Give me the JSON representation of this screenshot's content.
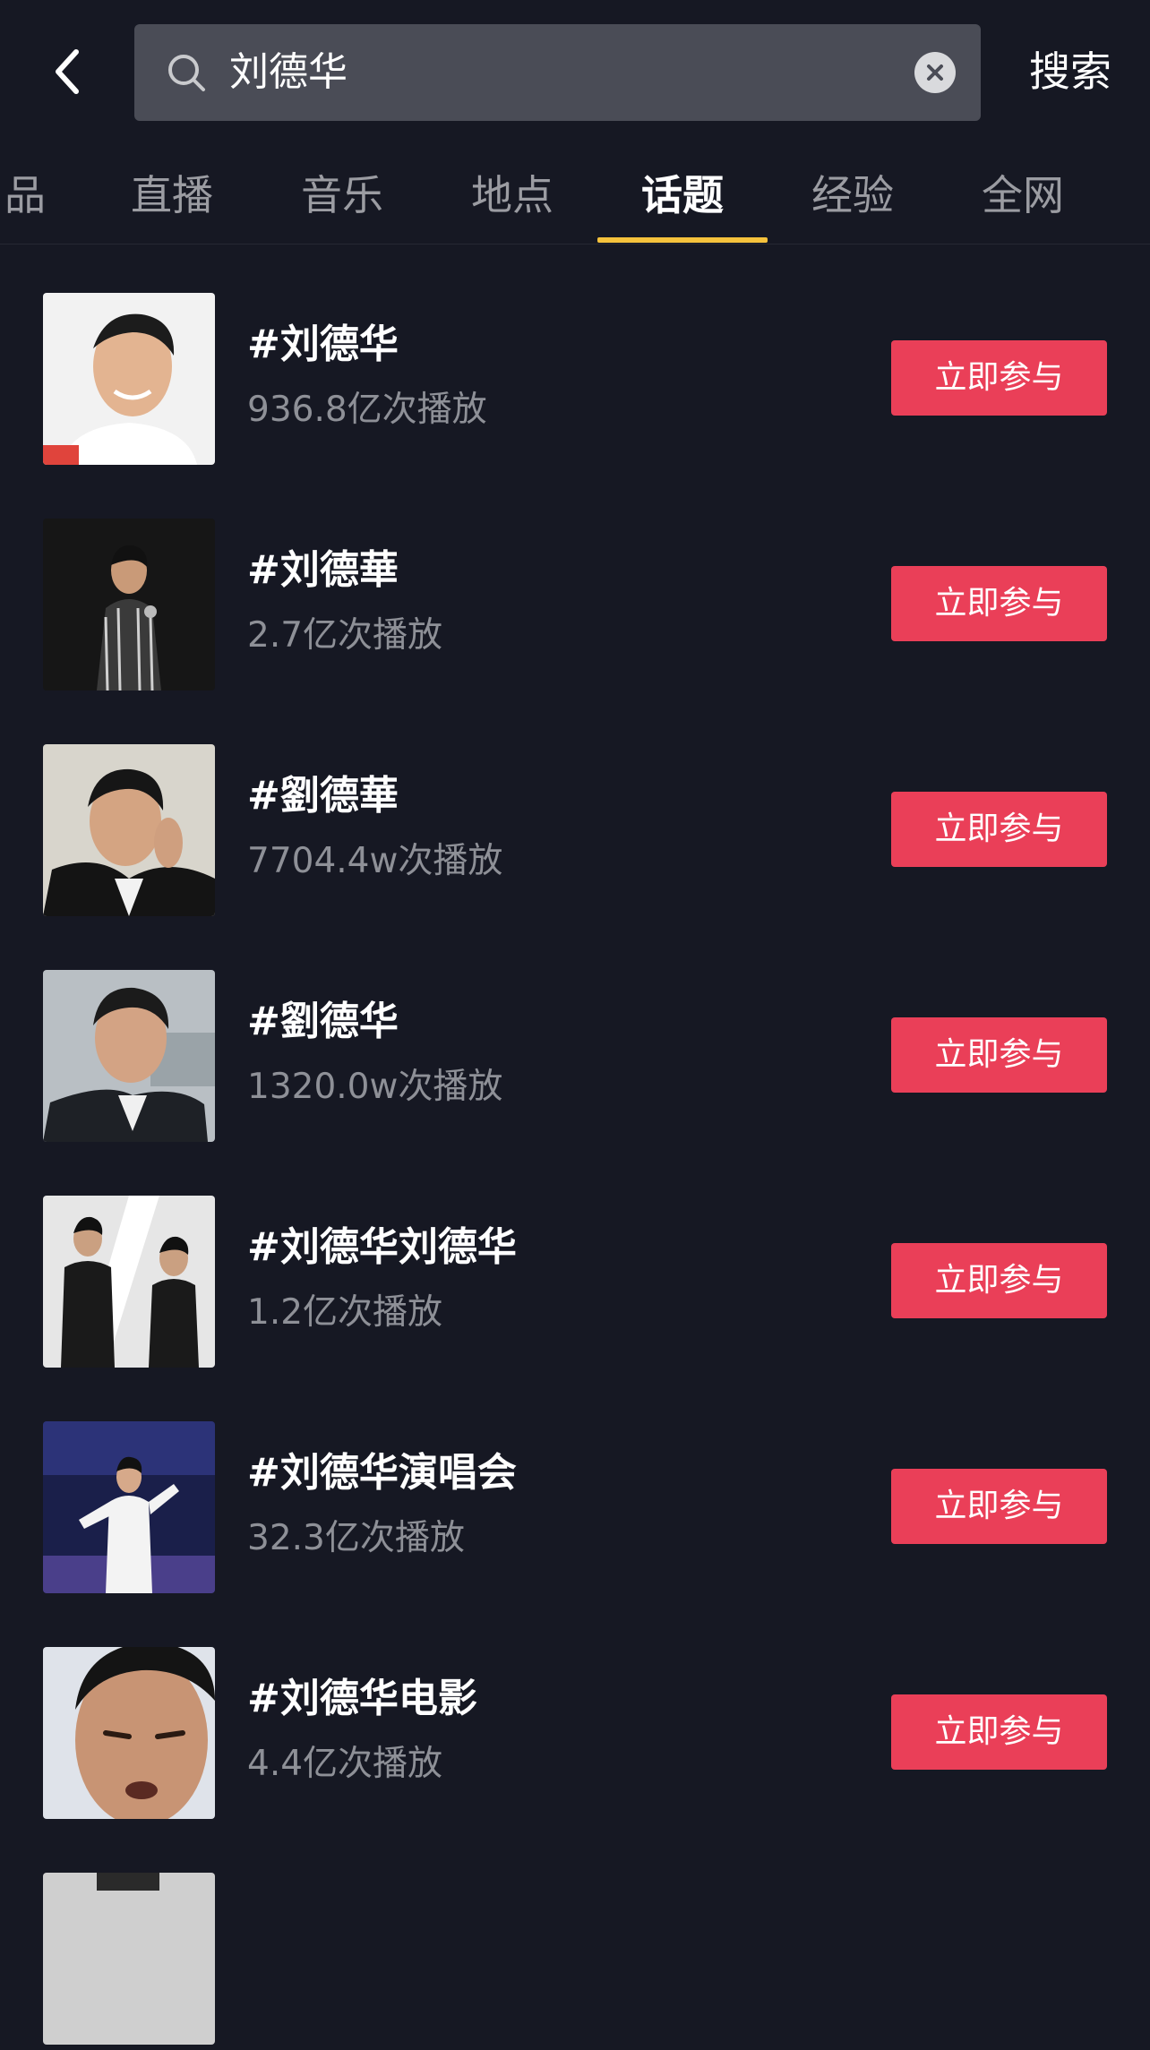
{
  "search": {
    "query": "刘德华",
    "search_label": "搜索"
  },
  "tabs": [
    {
      "label": "品"
    },
    {
      "label": "直播"
    },
    {
      "label": "音乐"
    },
    {
      "label": "地点"
    },
    {
      "label": "话题",
      "active": true
    },
    {
      "label": "经验"
    },
    {
      "label": "全网"
    }
  ],
  "topics": [
    {
      "title": "#刘德华",
      "plays": "936.8亿次播放",
      "action": "立即参与"
    },
    {
      "title": "#刘德華",
      "plays": "2.7亿次播放",
      "action": "立即参与"
    },
    {
      "title": "#劉德華",
      "plays": "7704.4w次播放",
      "action": "立即参与"
    },
    {
      "title": "#劉德华",
      "plays": "1320.0w次播放",
      "action": "立即参与"
    },
    {
      "title": "#刘德华刘德华",
      "plays": "1.2亿次播放",
      "action": "立即参与"
    },
    {
      "title": "#刘德华演唱会",
      "plays": "32.3亿次播放",
      "action": "立即参与"
    },
    {
      "title": "#刘德华电影",
      "plays": "4.4亿次播放",
      "action": "立即参与"
    }
  ],
  "colors": {
    "background": "#161823",
    "accent_button": "#ea3f58",
    "tab_indicator": "#f5c23c"
  }
}
